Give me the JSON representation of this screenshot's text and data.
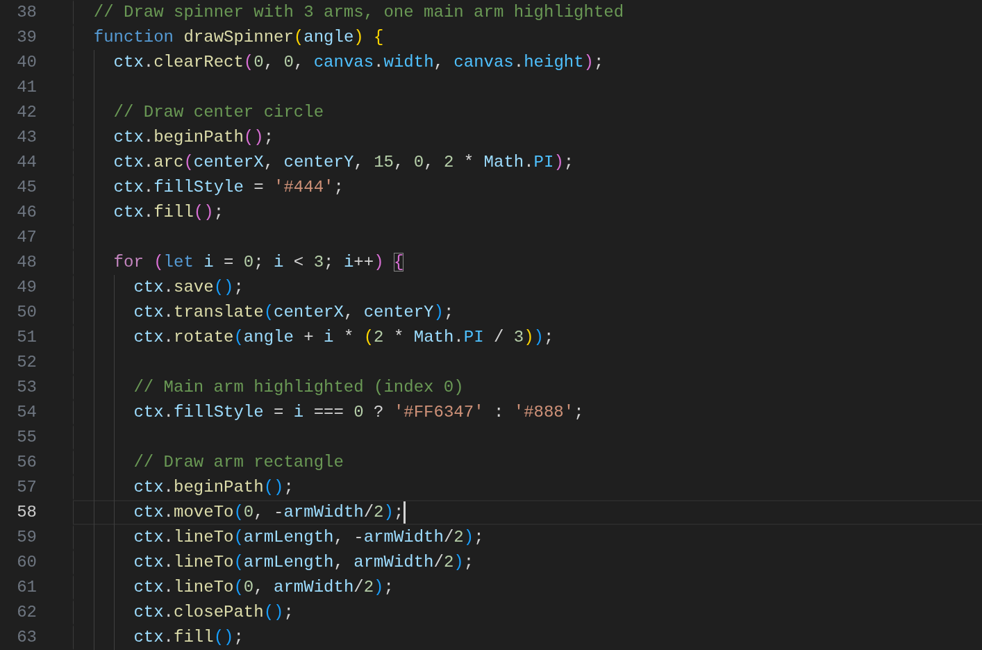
{
  "editor": {
    "lines": [
      {
        "number": "38",
        "current": false,
        "tokens": [
          {
            "kind": "comment",
            "text": "// Draw spinner with 3 arms, one main arm highlighted"
          }
        ]
      },
      {
        "number": "39",
        "current": false,
        "tokens": [
          {
            "kind": "keyword",
            "text": "function "
          },
          {
            "kind": "function",
            "text": "drawSpinner"
          },
          {
            "kind": "bracket1",
            "text": "("
          },
          {
            "kind": "variable",
            "text": "angle"
          },
          {
            "kind": "bracket1",
            "text": ") {"
          }
        ],
        "children": [
          {
            "number": "40",
            "current": false,
            "tokens": [
              {
                "kind": "variable",
                "text": "ctx"
              },
              {
                "kind": "plain",
                "text": "."
              },
              {
                "kind": "function",
                "text": "clearRect"
              },
              {
                "kind": "bracket2",
                "text": "("
              },
              {
                "kind": "number",
                "text": "0"
              },
              {
                "kind": "plain",
                "text": ", "
              },
              {
                "kind": "number",
                "text": "0"
              },
              {
                "kind": "plain",
                "text": ", "
              },
              {
                "kind": "constant",
                "text": "canvas"
              },
              {
                "kind": "plain",
                "text": "."
              },
              {
                "kind": "constant",
                "text": "width"
              },
              {
                "kind": "plain",
                "text": ", "
              },
              {
                "kind": "constant",
                "text": "canvas"
              },
              {
                "kind": "plain",
                "text": "."
              },
              {
                "kind": "constant",
                "text": "height"
              },
              {
                "kind": "bracket2",
                "text": ")"
              },
              {
                "kind": "plain",
                "text": ";"
              }
            ]
          },
          {
            "number": "41",
            "current": false
          },
          {
            "number": "42",
            "current": false,
            "tokens": [
              {
                "kind": "comment",
                "text": "// Draw center circle"
              }
            ]
          },
          {
            "number": "43",
            "current": false,
            "tokens": [
              {
                "kind": "variable",
                "text": "ctx"
              },
              {
                "kind": "plain",
                "text": "."
              },
              {
                "kind": "function",
                "text": "beginPath"
              },
              {
                "kind": "bracket2",
                "text": "()"
              },
              {
                "kind": "plain",
                "text": ";"
              }
            ]
          },
          {
            "number": "44",
            "current": false,
            "tokens": [
              {
                "kind": "variable",
                "text": "ctx"
              },
              {
                "kind": "plain",
                "text": "."
              },
              {
                "kind": "function",
                "text": "arc"
              },
              {
                "kind": "bracket2",
                "text": "("
              },
              {
                "kind": "variable",
                "text": "centerX"
              },
              {
                "kind": "plain",
                "text": ", "
              },
              {
                "kind": "variable",
                "text": "centerY"
              },
              {
                "kind": "plain",
                "text": ", "
              },
              {
                "kind": "number",
                "text": "15"
              },
              {
                "kind": "plain",
                "text": ", "
              },
              {
                "kind": "number",
                "text": "0"
              },
              {
                "kind": "plain",
                "text": ", "
              },
              {
                "kind": "number",
                "text": "2"
              },
              {
                "kind": "plain",
                "text": " * "
              },
              {
                "kind": "variable",
                "text": "Math"
              },
              {
                "kind": "plain",
                "text": "."
              },
              {
                "kind": "constant",
                "text": "PI"
              },
              {
                "kind": "bracket2",
                "text": ")"
              },
              {
                "kind": "plain",
                "text": ";"
              }
            ]
          },
          {
            "number": "45",
            "current": false,
            "tokens": [
              {
                "kind": "variable",
                "text": "ctx"
              },
              {
                "kind": "plain",
                "text": "."
              },
              {
                "kind": "variable",
                "text": "fillStyle"
              },
              {
                "kind": "plain",
                "text": " = "
              },
              {
                "kind": "string",
                "text": "'#444'"
              },
              {
                "kind": "plain",
                "text": ";"
              }
            ]
          },
          {
            "number": "46",
            "current": false,
            "tokens": [
              {
                "kind": "variable",
                "text": "ctx"
              },
              {
                "kind": "plain",
                "text": "."
              },
              {
                "kind": "function",
                "text": "fill"
              },
              {
                "kind": "bracket2",
                "text": "()"
              },
              {
                "kind": "plain",
                "text": ";"
              }
            ]
          },
          {
            "number": "47",
            "current": false
          },
          {
            "number": "48",
            "current": false,
            "tokens": [
              {
                "kind": "control",
                "text": "for "
              },
              {
                "kind": "bracket2",
                "text": "("
              },
              {
                "kind": "keyword",
                "text": "let "
              },
              {
                "kind": "variable",
                "text": "i"
              },
              {
                "kind": "plain",
                "text": " = "
              },
              {
                "kind": "number",
                "text": "0"
              },
              {
                "kind": "plain",
                "text": "; "
              },
              {
                "kind": "variable",
                "text": "i"
              },
              {
                "kind": "plain",
                "text": " < "
              },
              {
                "kind": "number",
                "text": "3"
              },
              {
                "kind": "plain",
                "text": "; "
              },
              {
                "kind": "variable",
                "text": "i"
              },
              {
                "kind": "plain",
                "text": "++"
              },
              {
                "kind": "bracket2",
                "text": ") "
              },
              {
                "kind": "matched",
                "text": "{"
              }
            ],
            "children": [
              {
                "number": "49",
                "current": false,
                "tokens": [
                  {
                    "kind": "variable",
                    "text": "ctx"
                  },
                  {
                    "kind": "plain",
                    "text": "."
                  },
                  {
                    "kind": "function",
                    "text": "save"
                  },
                  {
                    "kind": "bracket3",
                    "text": "()"
                  },
                  {
                    "kind": "plain",
                    "text": ";"
                  }
                ]
              },
              {
                "number": "50",
                "current": false,
                "tokens": [
                  {
                    "kind": "variable",
                    "text": "ctx"
                  },
                  {
                    "kind": "plain",
                    "text": "."
                  },
                  {
                    "kind": "function",
                    "text": "translate"
                  },
                  {
                    "kind": "bracket3",
                    "text": "("
                  },
                  {
                    "kind": "variable",
                    "text": "centerX"
                  },
                  {
                    "kind": "plain",
                    "text": ", "
                  },
                  {
                    "kind": "variable",
                    "text": "centerY"
                  },
                  {
                    "kind": "bracket3",
                    "text": ")"
                  },
                  {
                    "kind": "plain",
                    "text": ";"
                  }
                ]
              },
              {
                "number": "51",
                "current": false,
                "tokens": [
                  {
                    "kind": "variable",
                    "text": "ctx"
                  },
                  {
                    "kind": "plain",
                    "text": "."
                  },
                  {
                    "kind": "function",
                    "text": "rotate"
                  },
                  {
                    "kind": "bracket3",
                    "text": "("
                  },
                  {
                    "kind": "variable",
                    "text": "angle"
                  },
                  {
                    "kind": "plain",
                    "text": " + "
                  },
                  {
                    "kind": "variable",
                    "text": "i"
                  },
                  {
                    "kind": "plain",
                    "text": " * "
                  },
                  {
                    "kind": "bracket1",
                    "text": "("
                  },
                  {
                    "kind": "number",
                    "text": "2"
                  },
                  {
                    "kind": "plain",
                    "text": " * "
                  },
                  {
                    "kind": "variable",
                    "text": "Math"
                  },
                  {
                    "kind": "plain",
                    "text": "."
                  },
                  {
                    "kind": "constant",
                    "text": "PI"
                  },
                  {
                    "kind": "plain",
                    "text": " / "
                  },
                  {
                    "kind": "number",
                    "text": "3"
                  },
                  {
                    "kind": "bracket1",
                    "text": ")"
                  },
                  {
                    "kind": "bracket3",
                    "text": ")"
                  },
                  {
                    "kind": "plain",
                    "text": ";"
                  }
                ]
              },
              {
                "number": "52",
                "current": false
              },
              {
                "number": "53",
                "current": false,
                "tokens": [
                  {
                    "kind": "comment",
                    "text": "// Main arm highlighted (index 0)"
                  }
                ]
              },
              {
                "number": "54",
                "current": false,
                "tokens": [
                  {
                    "kind": "variable",
                    "text": "ctx"
                  },
                  {
                    "kind": "plain",
                    "text": "."
                  },
                  {
                    "kind": "variable",
                    "text": "fillStyle"
                  },
                  {
                    "kind": "plain",
                    "text": " = "
                  },
                  {
                    "kind": "variable",
                    "text": "i"
                  },
                  {
                    "kind": "plain",
                    "text": " === "
                  },
                  {
                    "kind": "number",
                    "text": "0"
                  },
                  {
                    "kind": "plain",
                    "text": " ? "
                  },
                  {
                    "kind": "string",
                    "text": "'#FF6347'"
                  },
                  {
                    "kind": "plain",
                    "text": " : "
                  },
                  {
                    "kind": "string",
                    "text": "'#888'"
                  },
                  {
                    "kind": "plain",
                    "text": ";"
                  }
                ]
              },
              {
                "number": "55",
                "current": false
              },
              {
                "number": "56",
                "current": false,
                "tokens": [
                  {
                    "kind": "comment",
                    "text": "// Draw arm rectangle"
                  }
                ]
              },
              {
                "number": "57",
                "current": false,
                "tokens": [
                  {
                    "kind": "variable",
                    "text": "ctx"
                  },
                  {
                    "kind": "plain",
                    "text": "."
                  },
                  {
                    "kind": "function",
                    "text": "beginPath"
                  },
                  {
                    "kind": "bracket3",
                    "text": "()"
                  },
                  {
                    "kind": "plain",
                    "text": ";"
                  }
                ]
              },
              {
                "number": "58",
                "current": true,
                "tokens": [
                  {
                    "kind": "variable",
                    "text": "ctx"
                  },
                  {
                    "kind": "plain",
                    "text": "."
                  },
                  {
                    "kind": "function",
                    "text": "moveTo"
                  },
                  {
                    "kind": "bracket3",
                    "text": "("
                  },
                  {
                    "kind": "number",
                    "text": "0"
                  },
                  {
                    "kind": "plain",
                    "text": ", -"
                  },
                  {
                    "kind": "variable",
                    "text": "armWidth"
                  },
                  {
                    "kind": "plain",
                    "text": "/"
                  },
                  {
                    "kind": "number",
                    "text": "2"
                  },
                  {
                    "kind": "bracket3",
                    "text": ")"
                  },
                  {
                    "kind": "plain",
                    "text": ";"
                  }
                ]
              },
              {
                "number": "59",
                "current": false,
                "tokens": [
                  {
                    "kind": "variable",
                    "text": "ctx"
                  },
                  {
                    "kind": "plain",
                    "text": "."
                  },
                  {
                    "kind": "function",
                    "text": "lineTo"
                  },
                  {
                    "kind": "bracket3",
                    "text": "("
                  },
                  {
                    "kind": "variable",
                    "text": "armLength"
                  },
                  {
                    "kind": "plain",
                    "text": ", -"
                  },
                  {
                    "kind": "variable",
                    "text": "armWidth"
                  },
                  {
                    "kind": "plain",
                    "text": "/"
                  },
                  {
                    "kind": "number",
                    "text": "2"
                  },
                  {
                    "kind": "bracket3",
                    "text": ")"
                  },
                  {
                    "kind": "plain",
                    "text": ";"
                  }
                ]
              },
              {
                "number": "60",
                "current": false,
                "tokens": [
                  {
                    "kind": "variable",
                    "text": "ctx"
                  },
                  {
                    "kind": "plain",
                    "text": "."
                  },
                  {
                    "kind": "function",
                    "text": "lineTo"
                  },
                  {
                    "kind": "bracket3",
                    "text": "("
                  },
                  {
                    "kind": "variable",
                    "text": "armLength"
                  },
                  {
                    "kind": "plain",
                    "text": ", "
                  },
                  {
                    "kind": "variable",
                    "text": "armWidth"
                  },
                  {
                    "kind": "plain",
                    "text": "/"
                  },
                  {
                    "kind": "number",
                    "text": "2"
                  },
                  {
                    "kind": "bracket3",
                    "text": ")"
                  },
                  {
                    "kind": "plain",
                    "text": ";"
                  }
                ]
              },
              {
                "number": "61",
                "current": false,
                "tokens": [
                  {
                    "kind": "variable",
                    "text": "ctx"
                  },
                  {
                    "kind": "plain",
                    "text": "."
                  },
                  {
                    "kind": "function",
                    "text": "lineTo"
                  },
                  {
                    "kind": "bracket3",
                    "text": "("
                  },
                  {
                    "kind": "number",
                    "text": "0"
                  },
                  {
                    "kind": "plain",
                    "text": ", "
                  },
                  {
                    "kind": "variable",
                    "text": "armWidth"
                  },
                  {
                    "kind": "plain",
                    "text": "/"
                  },
                  {
                    "kind": "number",
                    "text": "2"
                  },
                  {
                    "kind": "bracket3",
                    "text": ")"
                  },
                  {
                    "kind": "plain",
                    "text": ";"
                  }
                ]
              },
              {
                "number": "62",
                "current": false,
                "tokens": [
                  {
                    "kind": "variable",
                    "text": "ctx"
                  },
                  {
                    "kind": "plain",
                    "text": "."
                  },
                  {
                    "kind": "function",
                    "text": "closePath"
                  },
                  {
                    "kind": "bracket3",
                    "text": "()"
                  },
                  {
                    "kind": "plain",
                    "text": ";"
                  }
                ]
              },
              {
                "number": "63",
                "current": false,
                "tokens": [
                  {
                    "kind": "variable",
                    "text": "ctx"
                  },
                  {
                    "kind": "plain",
                    "text": "."
                  },
                  {
                    "kind": "function",
                    "text": "fill"
                  },
                  {
                    "kind": "bracket3",
                    "text": "()"
                  },
                  {
                    "kind": "plain",
                    "text": ";"
                  }
                ]
              }
            ]
          }
        ]
      }
    ]
  }
}
